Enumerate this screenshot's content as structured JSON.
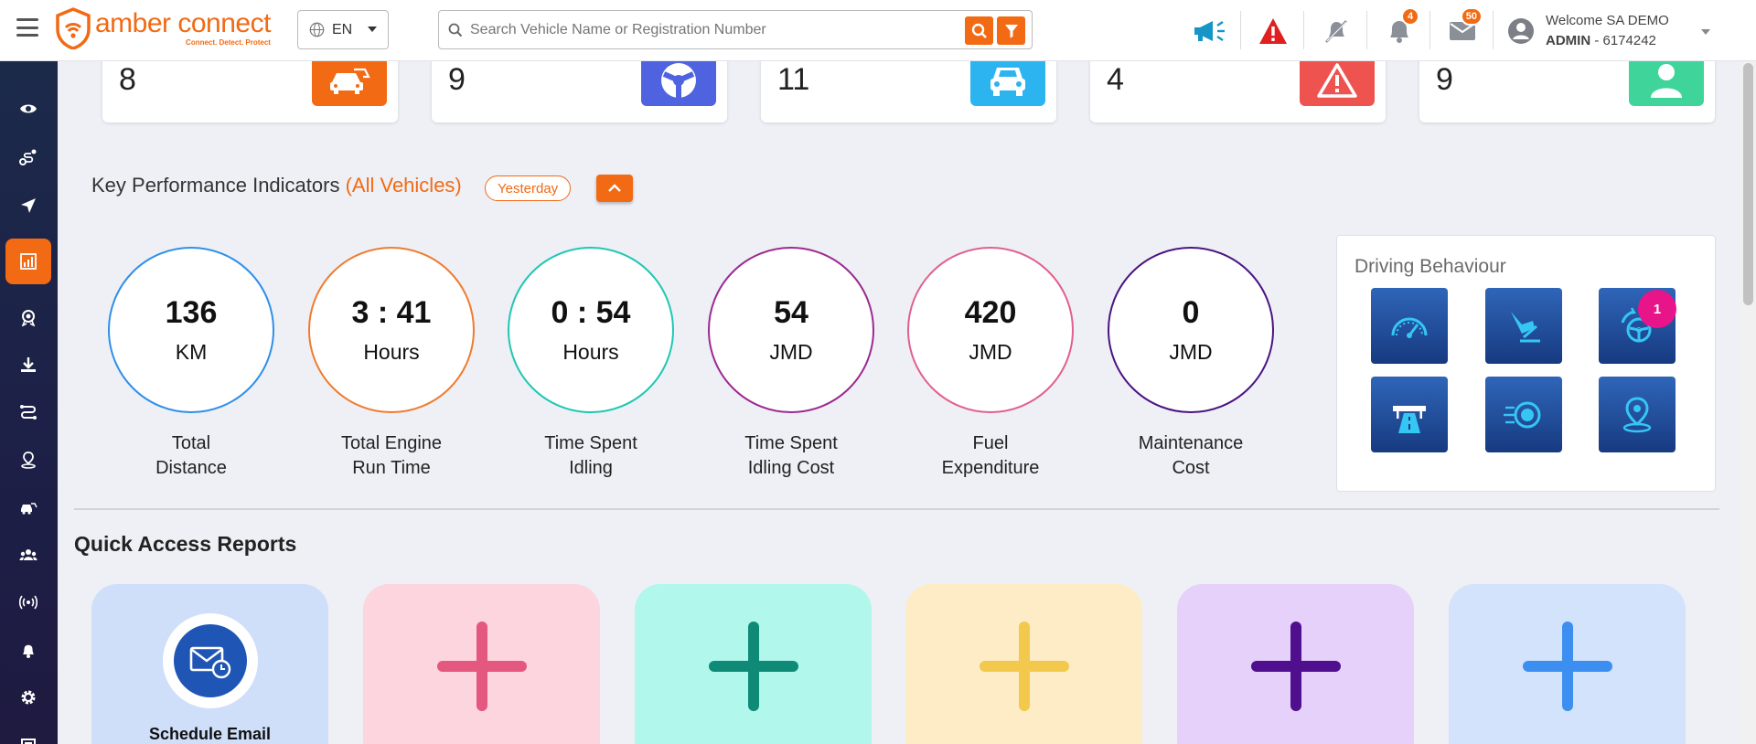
{
  "header": {
    "logo_word": "amber connect",
    "logo_tagline": "Connect. Detect. Protect",
    "language": "EN",
    "search_placeholder": "Search Vehicle Name or Registration Number",
    "notifications_count": "4",
    "messages_count": "50",
    "welcome": "Welcome SA DEMO",
    "role": "ADMIN",
    "account_id": " - 6174242"
  },
  "sidebar": {
    "items": [
      {
        "icon": "eye-icon"
      },
      {
        "icon": "route-icon"
      },
      {
        "icon": "navigate-icon"
      },
      {
        "icon": "analytics-icon",
        "active": true
      },
      {
        "icon": "badge-icon"
      },
      {
        "icon": "download-icon"
      },
      {
        "icon": "trip-icon"
      },
      {
        "icon": "geofence-icon"
      },
      {
        "icon": "vehicles-icon"
      },
      {
        "icon": "users-icon"
      },
      {
        "icon": "signal-icon"
      },
      {
        "icon": "alert-bell-icon"
      },
      {
        "icon": "settings-icon"
      },
      {
        "icon": "more-icon"
      }
    ]
  },
  "stats": [
    {
      "value": "8",
      "color": "#f26a13",
      "icon": "vehicles-icon"
    },
    {
      "value": "9",
      "color": "#4f62e0",
      "icon": "steering-icon"
    },
    {
      "value": "11",
      "color": "#2bb4ef",
      "icon": "car-icon"
    },
    {
      "value": "4",
      "color": "#ef5350",
      "icon": "warning-icon"
    },
    {
      "value": "9",
      "color": "#3ed49a",
      "icon": "driver-icon"
    }
  ],
  "kpi": {
    "title": "Key Performance Indicators",
    "scope": "(All Vehicles)",
    "period": "Yesterday",
    "items": [
      {
        "value": "136",
        "unit": "KM",
        "label_1": "Total",
        "label_2": "Distance",
        "color": "#2f8fe8"
      },
      {
        "value": "3 : 41",
        "unit": "Hours",
        "label_1": "Total Engine",
        "label_2": "Run Time",
        "color": "#ef7c2f"
      },
      {
        "value": "0 : 54",
        "unit": "Hours",
        "label_1": "Time Spent",
        "label_2": "Idling",
        "color": "#1fc7b2"
      },
      {
        "value": "54",
        "unit": "JMD",
        "label_1": "Time Spent",
        "label_2": "Idling Cost",
        "color": "#9c2a8f"
      },
      {
        "value": "420",
        "unit": "JMD",
        "label_1": "Fuel",
        "label_2": "Expenditure",
        "color": "#e0608f"
      },
      {
        "value": "0",
        "unit": "JMD",
        "label_1": "Maintenance",
        "label_2": "Cost",
        "color": "#4b1482"
      }
    ]
  },
  "driving_behaviour": {
    "title": "Driving Behaviour",
    "harsh_turning_count": "1",
    "buttons": [
      "speedometer-icon",
      "harsh-braking-icon",
      "harsh-turning-icon",
      "highway-icon",
      "acceleration-icon",
      "location-pin-icon"
    ]
  },
  "quick_access": {
    "title": "Quick Access Reports",
    "schedule_email": "Schedule Email",
    "cards": [
      {
        "bg": "#cfdff9"
      },
      {
        "bg": "#fcd5df",
        "plus": "#e4577f"
      },
      {
        "bg": "#b2f7ec",
        "plus": "#0f8a76"
      },
      {
        "bg": "#fdecc6",
        "plus": "#f2c94c"
      },
      {
        "bg": "#e6d1fa",
        "plus": "#4f0f8f"
      },
      {
        "bg": "#d3e3fb",
        "plus": "#3c8ef0"
      }
    ]
  }
}
